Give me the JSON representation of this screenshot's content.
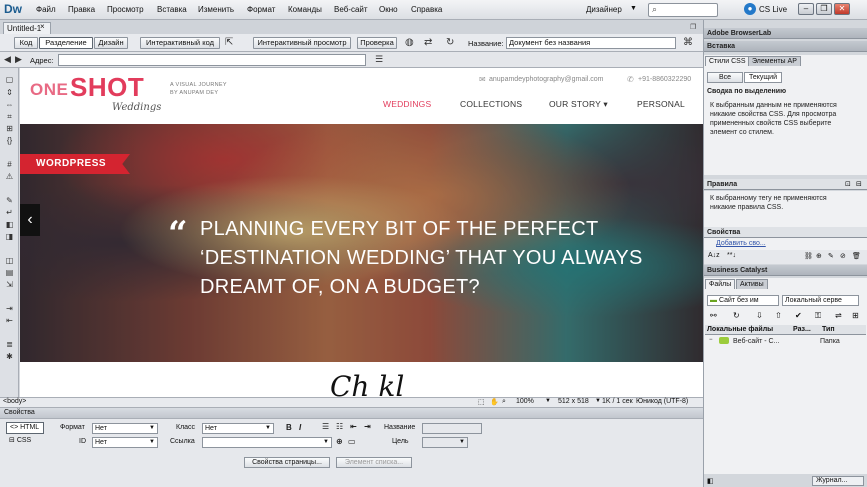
{
  "app": {
    "logo": "Dw",
    "menu": [
      "Файл",
      "Правка",
      "Просмотр",
      "Вставка",
      "Изменить",
      "Формат",
      "Команды",
      "Веб-сайт",
      "Окно",
      "Справка"
    ],
    "workspace": "Дизайнер",
    "cslive": "CS Live"
  },
  "document": {
    "tab_name": "Untitled-1",
    "view_buttons": [
      "Код",
      "Разделение",
      "Дизайн"
    ],
    "live_code": "Интерактивный код",
    "live_view": "Интерактивный просмотр",
    "inspect": "Проверка",
    "title_label": "Название:",
    "title_value": "Документ без названия",
    "address_label": "Адрес:",
    "address_value": ""
  },
  "site": {
    "logo_one": "ONE",
    "logo_shot": "SHOT",
    "logo_weddings": "Weddings",
    "tagline1": "A VISUAL JOURNEY",
    "tagline2": "BY ANUPAM DEY",
    "email": "anupamdeyphotography@gmail.com",
    "phone": "+91-8860322290",
    "nav": [
      "WEDDINGS",
      "COLLECTIONS",
      "OUR STORY ▾",
      "PERSONAL"
    ],
    "ribbon": "WORDPRESS",
    "slider_prev": "‹",
    "quote_mark": "“",
    "hero_lines": [
      "PLANNING EVERY BIT OF THE PERFECT",
      "‘DESTINATION WEDDING’ THAT YOU ALWAYS",
      "DREAMT OF, ON A BUDGET?"
    ],
    "script_heading": "Ch  kl  "
  },
  "status": {
    "tag": "<body>",
    "zoom": "100%",
    "dims": "512 x 518",
    "download": "1K / 1 сек",
    "encoding": "Юникод (UTF-8)"
  },
  "properties": {
    "title": "Свойства",
    "html": "HTML",
    "css": "CSS",
    "format_label": "Формат",
    "format_value": "Нет",
    "id_label": "ID",
    "id_value": "Нет",
    "class_label": "Класс",
    "class_value": "Нет",
    "link_label": "Ссылка",
    "link_value": "",
    "name_label": "Название",
    "target_label": "Цель",
    "page_props": "Свойства страницы...",
    "list_item": "Элемент списка..."
  },
  "panels": {
    "browserlab": "Adobe BrowserLab",
    "insert": "Вставка",
    "tab_css": "Стили CSS",
    "tab_ap": "Элементы AP",
    "all_btn": "Все",
    "current_btn": "Текущий",
    "summary_title": "Сводка по выделению",
    "summary_text": [
      "К выбранным данным не применяются",
      "никакие свойства CSS.  Для просмотра",
      "примененных свойств CSS выберите",
      "элемент со стилем."
    ],
    "rules_title": "Правила",
    "rules_text": [
      "К выбранному тегу не применяются",
      "никакие правила CSS."
    ],
    "props_title": "Свойства",
    "add_prop": "Добавить сво...",
    "business_catalyst": "Business Catalyst",
    "files_tab": "Файлы",
    "assets_tab": "Активы",
    "site_select": "Сайт без им",
    "server_select": "Локальный серве",
    "col_local": "Локальные файлы",
    "col_size": "Раз...",
    "col_type": "Тип",
    "row_name": "Веб-сайт - С...",
    "row_type": "Папка",
    "journal": "Журнал..."
  }
}
